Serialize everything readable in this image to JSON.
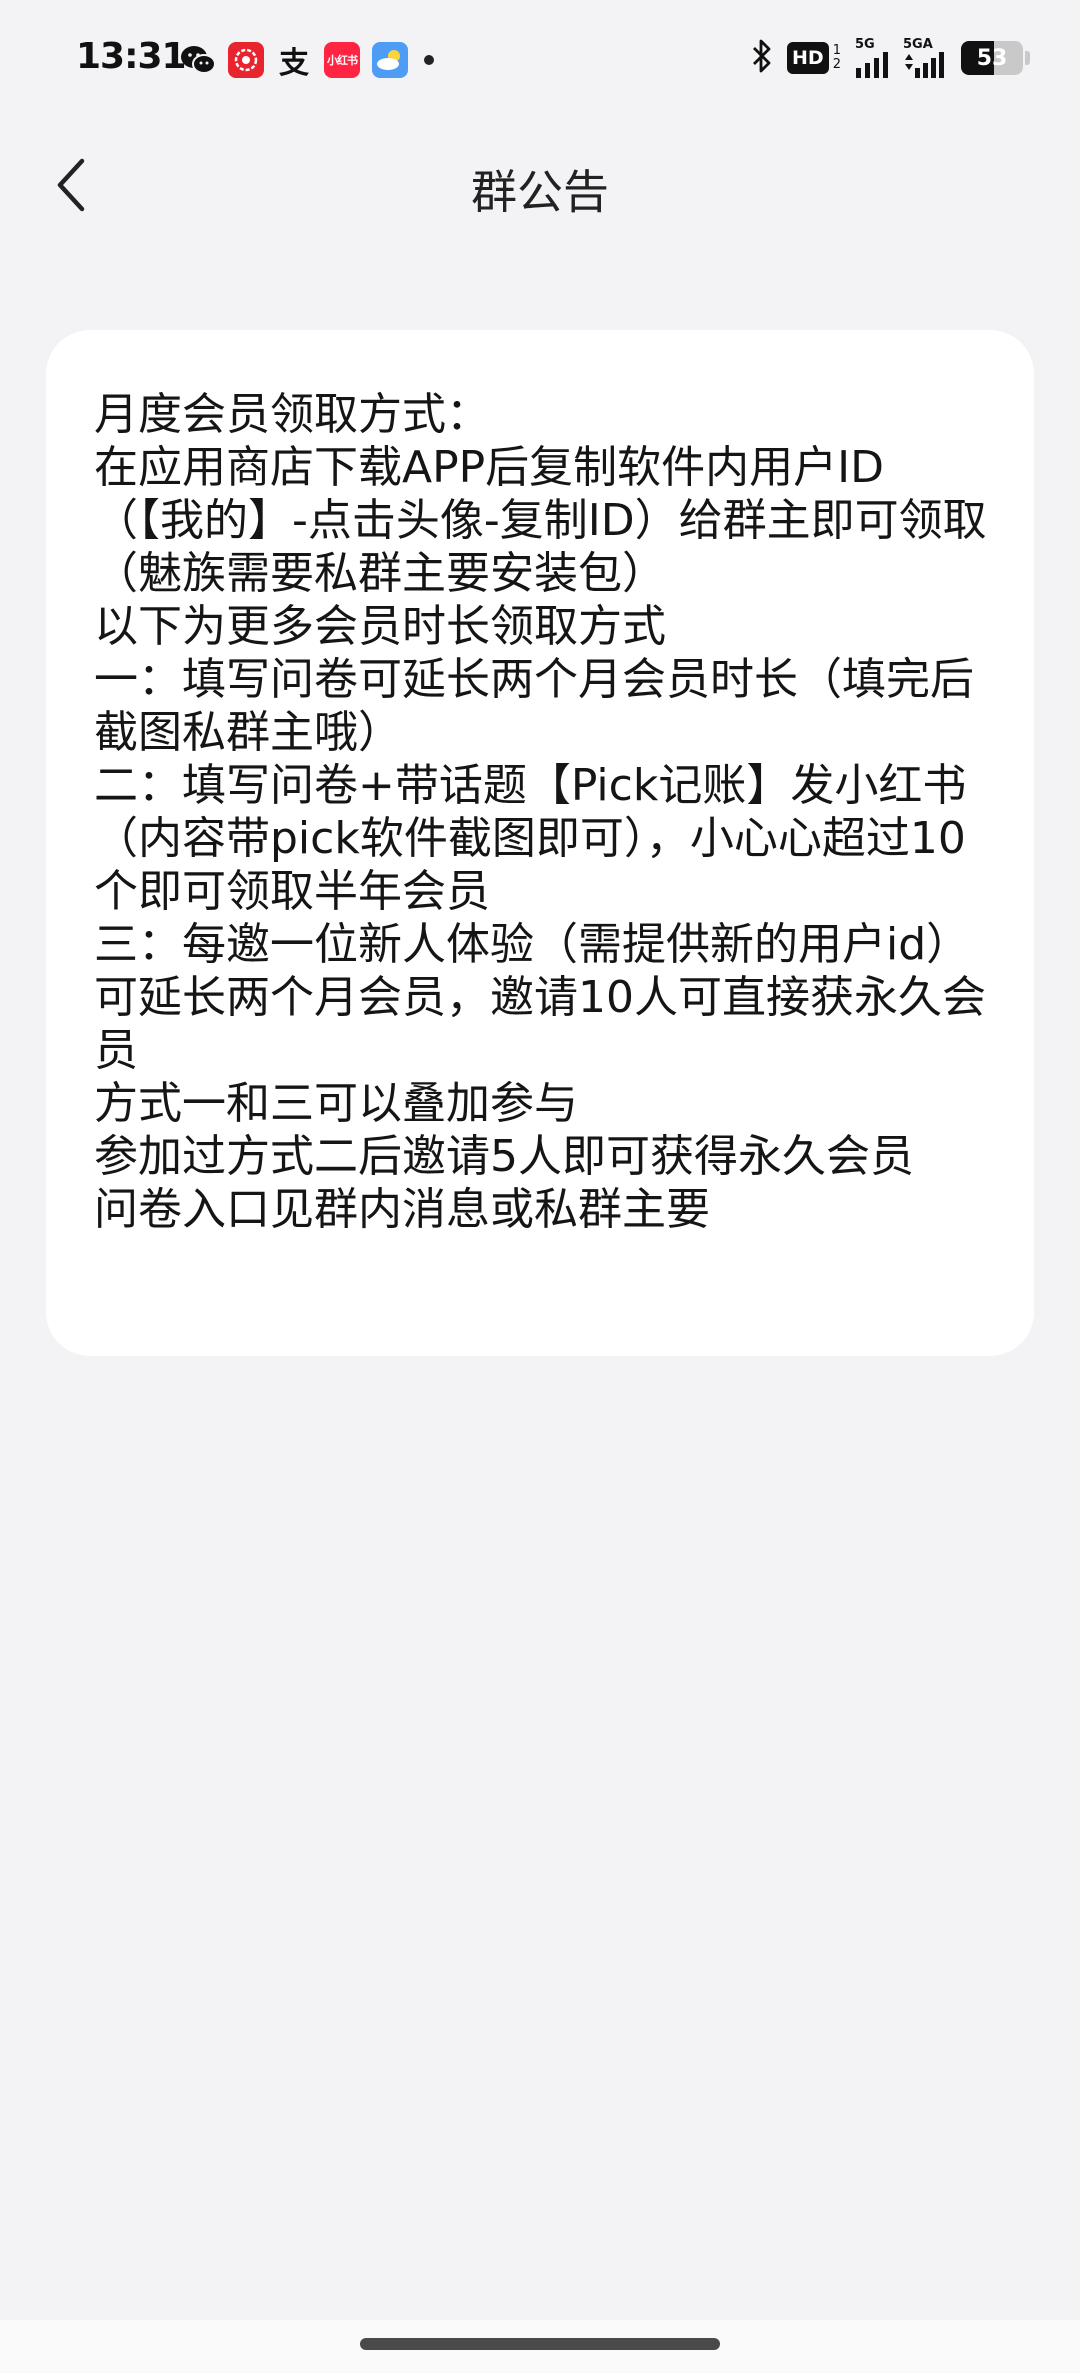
{
  "status_bar": {
    "time": "13:31",
    "notification_icons": [
      "wechat-icon",
      "app-red-icon",
      "alipay-icon",
      "xiaohongshu-icon",
      "weather-icon"
    ],
    "xhs_label": "小红书",
    "alipay_label": "支",
    "hd_label": "HD",
    "hd_sub_1": "1",
    "hd_sub_2": "2",
    "signal_1_label": "5G",
    "signal_2_label": "5GA",
    "battery_level": "53",
    "battery_fraction": 0.53
  },
  "nav": {
    "title": "群公告"
  },
  "announcement": {
    "lines": [
      "月度会员领取方式：",
      "在应用商店下载APP后复制软件内用户ID（【我的】-点击头像-复制ID）给群主即可领取",
      "（魅族需要私群主要安装包）",
      "以下为更多会员时长领取方式",
      "一：填写问卷可延长两个月会员时长（填完后截图私群主哦）",
      "二：填写问卷+带话题【Pick记账】发小红书（内容带pick软件截图即可），小心心超过10个即可领取半年会员",
      "三：每邀一位新人体验（需提供新的用户id）可延长两个月会员，邀请10人可直接获永久会员",
      "方式一和三可以叠加参与",
      "参加过方式二后邀请5人即可获得永久会员",
      "问卷入口见群内消息或私群主要"
    ]
  }
}
